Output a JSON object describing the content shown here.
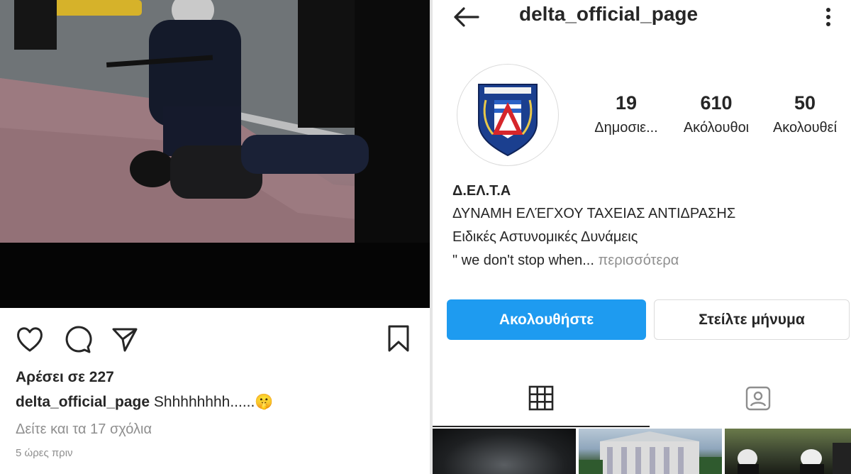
{
  "post": {
    "likes": "Αρέσει σε 227",
    "caption_user": "delta_official_page",
    "caption_text": "Shhhhhhhh......",
    "caption_emoji": "🤫",
    "comments_link": "Δείτε και τα 17 σχόλια",
    "time": "5 ώρες πριν",
    "actions": [
      "heart-icon",
      "comment-icon",
      "share-icon",
      "bookmark-icon"
    ]
  },
  "profile": {
    "username": "delta_official_page",
    "stats": [
      {
        "value": "19",
        "label": "Δημοσιε..."
      },
      {
        "value": "610",
        "label": "Ακόλουθοι"
      },
      {
        "value": "50",
        "label": "Ακολουθεί"
      }
    ],
    "bio": {
      "name": "Δ.ΕΛ.Τ.Α",
      "line1": "ΔΥΝΑΜΗ ΕΛΈΓΧΟΥ ΤΑΧΕΙΑΣ ΑΝΤΙΔΡΑΣΗΣ",
      "line2": "Ειδικές Αστυνομικές Δυνάμεις",
      "line3": "\" we don't stop when...",
      "more": "περισσότερα"
    },
    "follow_label": "Ακολουθήστε",
    "message_label": "Στείλτε μήνυμα",
    "tabs": [
      "grid-icon",
      "tagged-icon"
    ]
  },
  "colors": {
    "accent": "#1e9bf0",
    "text": "#262626",
    "muted": "#8e8e8e",
    "border": "#dbdbdb"
  }
}
